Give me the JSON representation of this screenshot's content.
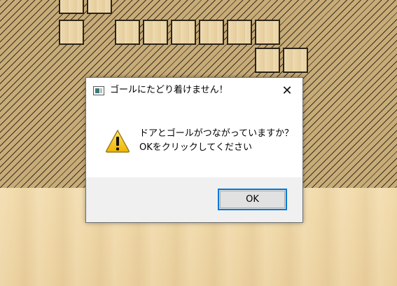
{
  "dialog": {
    "title": "ゴールにたどり着けません！",
    "close_glyph": "✕",
    "message_line1": "ドアとゴールがつながっていますか？",
    "message_line2": "OKをクリックしてください",
    "ok_label": "OK",
    "icon": "warning-icon"
  },
  "colors": {
    "accent": "#0078d7",
    "footer": "#f0f0f0",
    "warning_yellow": "#f5c400"
  }
}
